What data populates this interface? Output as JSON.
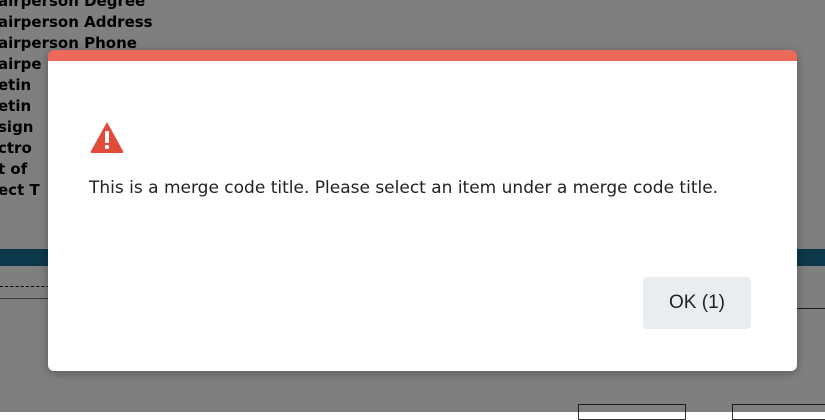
{
  "background": {
    "list_items": [
      "airperson Degree",
      "airperson Address",
      "airperson Phone",
      "airpe",
      "etin",
      "etin",
      "sign",
      "ctro",
      "t of",
      "ect T"
    ],
    "row_text": "etin"
  },
  "dialog": {
    "icon": "warning-triangle-icon",
    "accent_color": "#eb6a5a",
    "message": "This is a merge code title. Please select an item under a merge code title.",
    "ok_label": "OK (1)"
  }
}
